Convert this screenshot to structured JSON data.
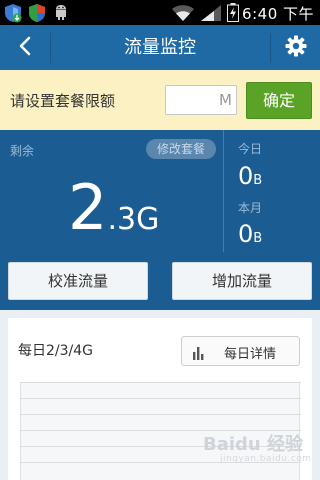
{
  "status_bar": {
    "time": "6:40 下午",
    "icons": [
      "usb-shield-icon",
      "shield-icon",
      "android-icon",
      "wifi-icon",
      "signal-icon",
      "battery-charging-icon"
    ]
  },
  "title_bar": {
    "title": "流量监控",
    "back_icon": "chevron-left-icon",
    "settings_icon": "gear-icon"
  },
  "limit_setting": {
    "label": "请设置套餐限额",
    "input_value": "",
    "unit": "M",
    "confirm_label": "确定"
  },
  "stats": {
    "remaining_label": "剩余",
    "modify_label": "修改套餐",
    "remaining_value": "2",
    "remaining_unit": ".3G",
    "today_label": "今日",
    "today_value": "0",
    "today_unit": "B",
    "month_label": "本月",
    "month_value": "0",
    "month_unit": "B"
  },
  "actions": {
    "calibrate_label": "校准流量",
    "add_label": "增加流量"
  },
  "daily": {
    "label": "每日2/3/4G",
    "detail_label": "每日详情",
    "detail_icon": "bar-chart-icon"
  },
  "watermark": {
    "text": "Baidu 经验",
    "sub": "jingyan.baidu.com"
  },
  "colors": {
    "primary": "#1f6aa5",
    "dark": "#1b5d92",
    "confirm": "#5aa327",
    "limit_bg": "#fbf1c2"
  }
}
